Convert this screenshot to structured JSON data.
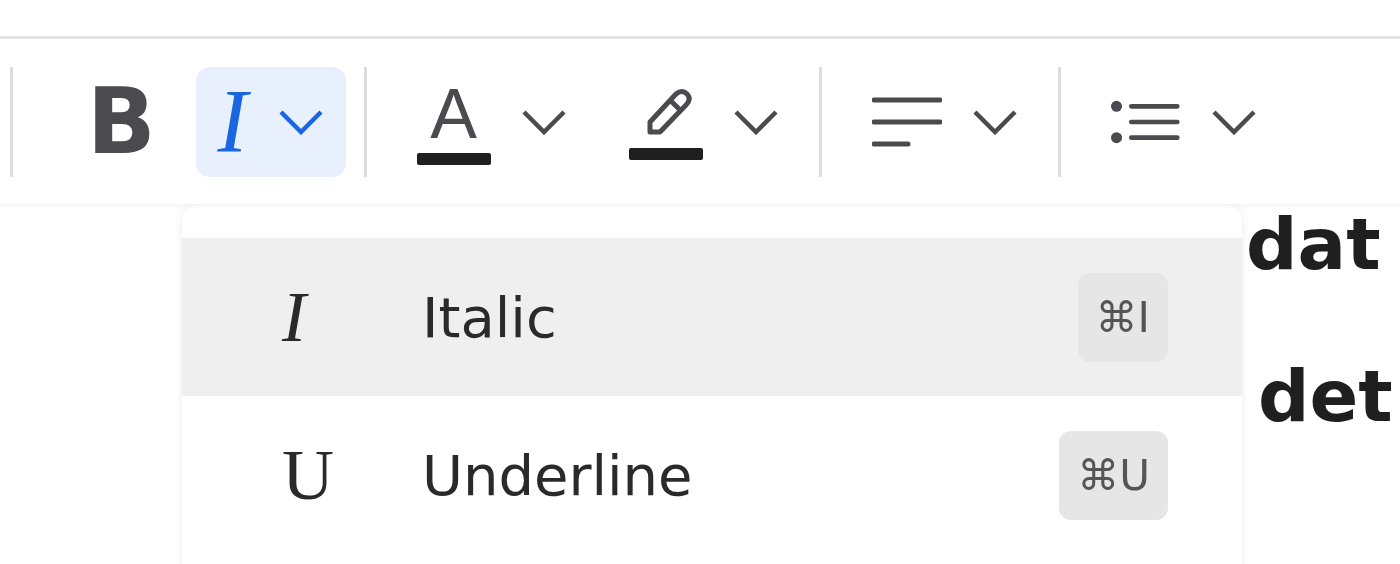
{
  "toolbar": [
    {
      "kind": "separator"
    },
    {
      "kind": "bold",
      "glyph": "B",
      "selected": false,
      "menu": false
    },
    {
      "kind": "italic",
      "glyph": "I",
      "selected": true,
      "menu": true
    },
    {
      "kind": "separator"
    },
    {
      "kind": "text-color",
      "glyph": "A",
      "color": "#1f1f1f",
      "selected": false,
      "menu": true
    },
    {
      "kind": "highlight",
      "color": "#1f1f1f",
      "selected": false,
      "menu": true
    },
    {
      "kind": "separator"
    },
    {
      "kind": "align",
      "selected": false,
      "menu": true
    },
    {
      "kind": "separator"
    },
    {
      "kind": "list",
      "selected": false,
      "menu": true
    }
  ],
  "editor": {
    "lines": [
      "dat",
      "det"
    ]
  },
  "menu": {
    "items": [
      {
        "glyph": "I",
        "label": "Italic",
        "shortcut": "⌘I",
        "selected": true
      },
      {
        "glyph": "U",
        "label": "Underline",
        "shortcut": "⌘U",
        "selected": false
      }
    ]
  }
}
